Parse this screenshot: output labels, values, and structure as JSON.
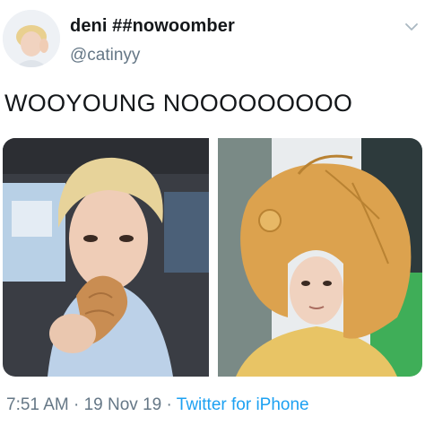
{
  "user": {
    "display_name": "deni ##nowoomber",
    "handle": "@catinyy",
    "avatar_icon": "profile-avatar"
  },
  "tweet": {
    "text": "WOOYOUNG NOOOOOOOOO"
  },
  "media": {
    "images": [
      {
        "name": "blonde-person-holding-fish-pastry"
      },
      {
        "name": "person-wearing-fish-hat"
      }
    ]
  },
  "meta": {
    "time": "7:51 AM",
    "separator": " · ",
    "date": "19 Nov 19",
    "source": "Twitter for iPhone"
  },
  "colors": {
    "text": "#14171a",
    "secondary": "#657786",
    "link": "#1da1f2"
  },
  "icons": {
    "more": "chevron-down-icon"
  }
}
